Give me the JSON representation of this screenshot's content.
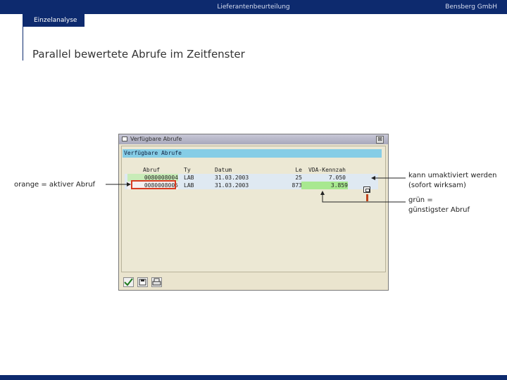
{
  "header": {
    "center_title": "Lieferantenbeurteilung",
    "company": "Bensberg GmbH",
    "tab": "Einzelanalyse"
  },
  "slide": {
    "headline": "Parallel bewertete Abrufe im Zeitfenster"
  },
  "sap_window": {
    "title": "Verfügbare Abrufe",
    "close": "⊠",
    "heading": "Verfügbare Abrufe",
    "columns": [
      "Abruf",
      "Ty",
      "Datum",
      "Le",
      "VDA-Kennzah"
    ],
    "rows": [
      {
        "abruf": "0080008004",
        "ty": "LAB",
        "datum": "31.03.2003",
        "le": "25",
        "kennzahl": "7.050"
      },
      {
        "abruf": "0080008005",
        "ty": "LAB",
        "datum": "31.03.2003",
        "le": "873",
        "kennzahl": "3.859"
      }
    ]
  },
  "annotations": {
    "left": "orange = aktiver Abruf",
    "right1_line1": "kann umaktiviert werden",
    "right1_line2": "(sofort wirksam)",
    "right2_line1": "grün =",
    "right2_line2": "günstigster Abruf"
  },
  "colors": {
    "brand": "#0d2a6e",
    "highlight_active": "#d83a20",
    "highlight_best": "#a8e890",
    "sap_heading": "#86cde6"
  },
  "icons": [
    "window-icon",
    "close-icon",
    "activate-icon",
    "warning-icon",
    "check-icon",
    "save-icon",
    "print-icon"
  ]
}
